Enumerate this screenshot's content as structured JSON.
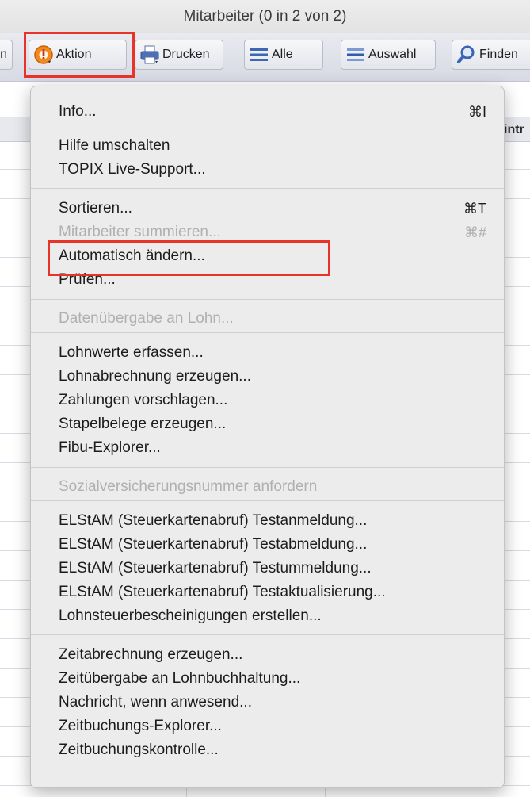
{
  "window": {
    "title": "Mitarbeiter (0 in 2 von 2)"
  },
  "toolbar": {
    "prev_partial": "n",
    "aktion": "Aktion",
    "drucken": "Drucken",
    "alle": "Alle",
    "auswahl": "Auswahl",
    "finden": "Finden"
  },
  "table": {
    "col_fragment": "intr"
  },
  "menu": {
    "items": [
      {
        "label": "Info...",
        "shortcut": "⌘I",
        "enabled": true
      },
      {
        "label": "Hilfe umschalten",
        "shortcut": "",
        "enabled": true
      },
      {
        "label": "TOPIX Live-Support...",
        "shortcut": "",
        "enabled": true
      },
      {
        "label": "Sortieren...",
        "shortcut": "⌘T",
        "enabled": true
      },
      {
        "label": "Mitarbeiter summieren...",
        "shortcut": "⌘#",
        "enabled": false
      },
      {
        "label": "Automatisch ändern...",
        "shortcut": "",
        "enabled": true
      },
      {
        "label": "Prüfen...",
        "shortcut": "",
        "enabled": true
      },
      {
        "label": "Datenübergabe an Lohn...",
        "shortcut": "",
        "enabled": false
      },
      {
        "label": "Lohnwerte erfassen...",
        "shortcut": "",
        "enabled": true
      },
      {
        "label": "Lohnabrechnung erzeugen...",
        "shortcut": "",
        "enabled": true
      },
      {
        "label": "Zahlungen vorschlagen...",
        "shortcut": "",
        "enabled": true
      },
      {
        "label": "Stapelbelege erzeugen...",
        "shortcut": "",
        "enabled": true
      },
      {
        "label": "Fibu-Explorer...",
        "shortcut": "",
        "enabled": true
      },
      {
        "label": "Sozialversicherungsnummer anfordern",
        "shortcut": "",
        "enabled": false
      },
      {
        "label": "ELStAM (Steuerkartenabruf) Testanmeldung...",
        "shortcut": "",
        "enabled": true
      },
      {
        "label": "ELStAM (Steuerkartenabruf) Testabmeldung...",
        "shortcut": "",
        "enabled": true
      },
      {
        "label": "ELStAM (Steuerkartenabruf) Testummeldung...",
        "shortcut": "",
        "enabled": true
      },
      {
        "label": "ELStAM (Steuerkartenabruf) Testaktualisierung...",
        "shortcut": "",
        "enabled": true
      },
      {
        "label": "Lohnsteuerbescheinigungen erstellen...",
        "shortcut": "",
        "enabled": true
      },
      {
        "label": "Zeitabrechnung erzeugen...",
        "shortcut": "",
        "enabled": true
      },
      {
        "label": "Zeitübergabe an Lohnbuchhaltung...",
        "shortcut": "",
        "enabled": true
      },
      {
        "label": "Nachricht, wenn anwesend...",
        "shortcut": "",
        "enabled": true
      },
      {
        "label": "Zeitbuchungs-Explorer...",
        "shortcut": "",
        "enabled": true
      },
      {
        "label": "Zeitbuchungskontrolle...",
        "shortcut": "",
        "enabled": true
      }
    ]
  },
  "colors": {
    "highlight_box": "#e8332a"
  }
}
